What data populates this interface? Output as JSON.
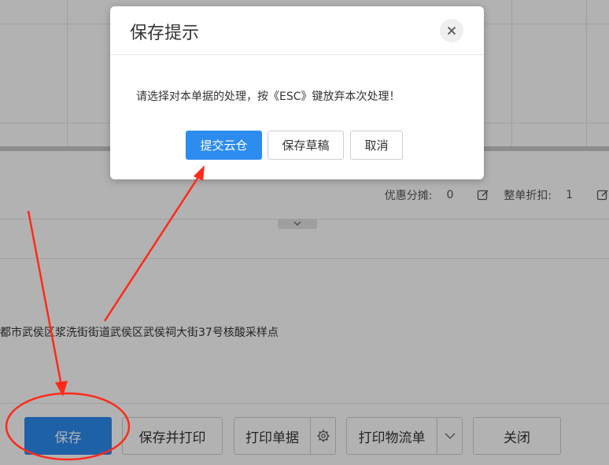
{
  "summary": {
    "discount_label": "优惠分摊:",
    "discount_value": "0",
    "whole_discount_label": "整单折扣:",
    "whole_discount_value": "1"
  },
  "address_text": "都市武侯区浆洗街街道武侯区武侯祠大街37号核酸采样点",
  "toolbar": {
    "save_label": "保存",
    "save_print_label": "保存并打印",
    "print_doc_label": "打印单据",
    "print_logistics_label": "打印物流单",
    "close_label": "关闭"
  },
  "dialog": {
    "title": "保存提示",
    "message": "请选择对本单据的处理，按《ESC》键放弃本次处理！",
    "submit_label": "提交云仓",
    "draft_label": "保存草稿",
    "cancel_label": "取消"
  },
  "colors": {
    "primary": "#2d8cf0",
    "annotation": "#ff2a1a"
  },
  "icons": [
    "close-icon",
    "edit-icon",
    "chevron-down-icon",
    "gear-icon"
  ]
}
